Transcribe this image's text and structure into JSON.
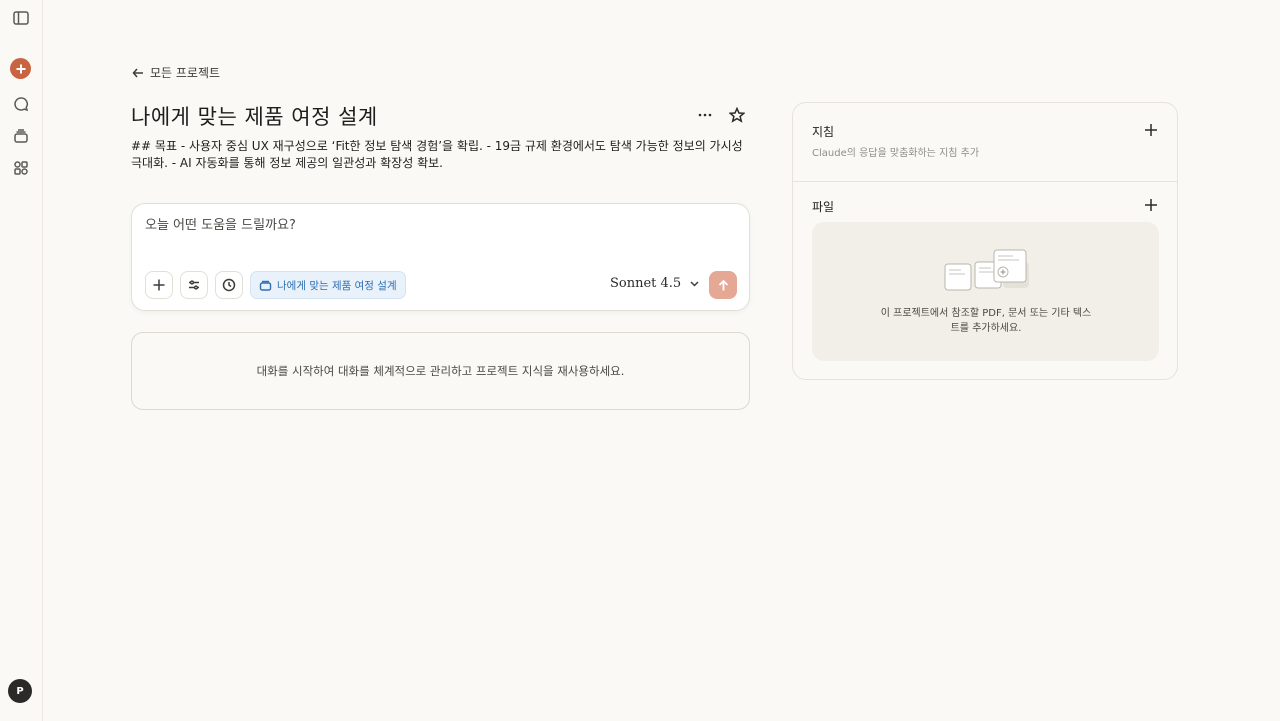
{
  "rail": {
    "avatar_initial": "P"
  },
  "header": {
    "back_label": "모든 프로젝트",
    "title": "나에게 맞는 제품 여정 설계",
    "description": "## 목표 - 사용자 중심 UX 재구성으로 ‘Fit한 정보 탐색 경험’을 확립. - 19금 규제 환경에서도 탐색 가능한 정보의 가시성 극대화. - AI 자동화를 통해 정보 제공의 일관성과 확장성 확보."
  },
  "composer": {
    "placeholder": "오늘 어떤 도움을 드릴까요?",
    "project_chip": "나에게 맞는 제품 여정 설계",
    "model": "Sonnet 4.5"
  },
  "empty_state": {
    "text": "대화를 시작하여 대화를 체계적으로 관리하고 프로젝트 지식을 재사용하세요."
  },
  "panel": {
    "instructions_title": "지침",
    "instructions_sub": "Claude의 응답을 맞춤화하는 지침 추가",
    "files_title": "파일",
    "files_empty_line1": "이 프로젝트에서 참조할 PDF, 문서 또는 기타 텍스",
    "files_empty_line2": "트를 추가하세요."
  },
  "colors": {
    "accent": "#c96442",
    "send_disabled": "#e5a895",
    "chip_bg": "#e9f1fa",
    "chip_text": "#2f6fb0",
    "background": "#faf9f5"
  }
}
